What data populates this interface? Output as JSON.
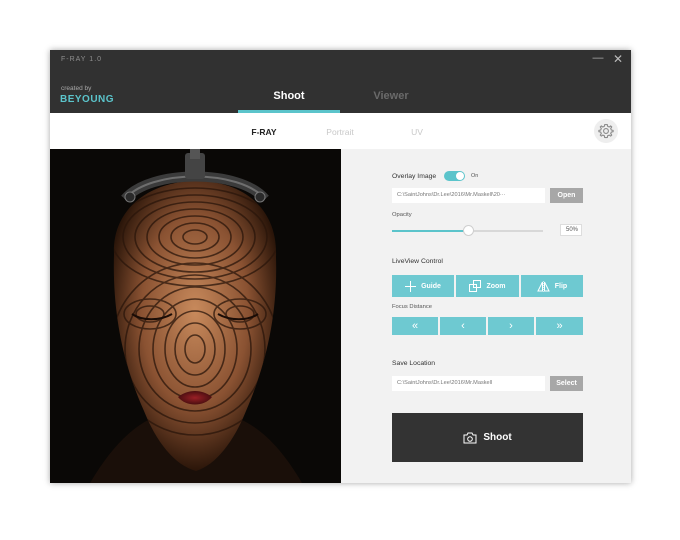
{
  "app": {
    "title": "F-RAY 1.0",
    "brand_small": "created by",
    "brand_logo": "BEYOUNG"
  },
  "window_controls": {
    "minimize": "—",
    "close": "✕"
  },
  "main_tabs": [
    {
      "label": "Shoot",
      "active": true
    },
    {
      "label": "Viewer",
      "active": false
    }
  ],
  "sub_tabs": [
    {
      "label": "F-RAY",
      "active": true
    },
    {
      "label": "Portrait",
      "active": false
    },
    {
      "label": "UV",
      "active": false
    }
  ],
  "icons": {
    "settings": "gear-icon",
    "guide": "plus-icon",
    "zoom": "zoom-squares-icon",
    "flip": "flip-icon",
    "first": "double-chevron-left-icon",
    "prev": "chevron-left-icon",
    "next": "chevron-right-icon",
    "last": "double-chevron-right-icon",
    "camera": "camera-icon"
  },
  "overlay": {
    "label": "Overlay Image",
    "toggle_state": "On",
    "toggle_on": true,
    "path": "C:\\SaintJohns\\Dr.Lee\\2016\\Mr.Maskell\\20···",
    "open_label": "Open",
    "opacity_label": "Opacity",
    "opacity_value": "50%",
    "opacity_fraction": 0.5
  },
  "liveview": {
    "label": "LiveView Control",
    "guide_label": "Guide",
    "zoom_label": "Zoom",
    "flip_label": "Flip",
    "focus_label": "Focus Distance",
    "first_glyph": "«",
    "prev_glyph": "‹",
    "next_glyph": "›",
    "last_glyph": "»"
  },
  "save": {
    "label": "Save Location",
    "path": "C:\\SaintJohns\\Dr.Lee\\2016\\Mr.Maskell",
    "select_label": "Select"
  },
  "shoot_button": {
    "label": "Shoot"
  },
  "colors": {
    "accent": "#5bc4cb",
    "button_teal": "#6ec9d1",
    "header_bg": "#313131",
    "shoot_bg": "#333333"
  }
}
